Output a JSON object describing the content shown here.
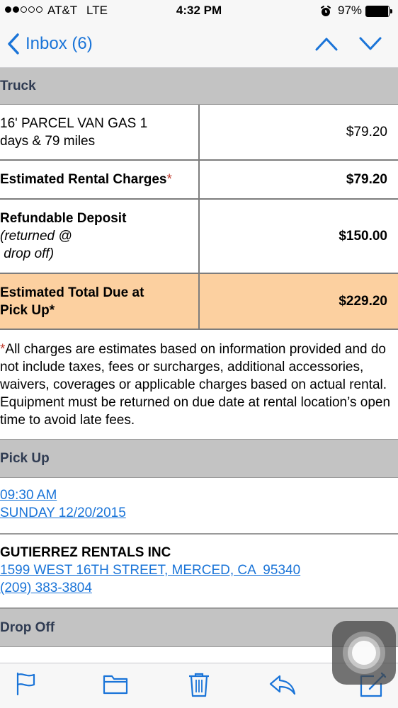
{
  "status_bar": {
    "carrier": "AT&T",
    "network": "LTE",
    "time": "4:32 PM",
    "battery": "97%",
    "battery_level": 0.97,
    "signal_bars": 2,
    "signal_total": 5
  },
  "nav": {
    "back_label": "Inbox (6)",
    "accent": "#1a74d8"
  },
  "email": {
    "truck_header": "Truck",
    "item": {
      "description_line1": "16' PARCEL VAN GAS 1",
      "description_line2": "days & 79 miles",
      "price": "$79.20"
    },
    "rental_charges": {
      "label": "Estimated Rental Charges",
      "asterisk": "*",
      "value": "$79.20"
    },
    "deposit": {
      "label": "Refundable Deposit",
      "note_line1": "(returned @",
      "note_line2": " drop off)",
      "value": "$150.00"
    },
    "total_due": {
      "label_line1": "Estimated Total Due at",
      "label_line2": "Pick Up*",
      "value": "$229.20",
      "highlight_color": "#fcd0a0"
    },
    "disclaimer": {
      "asterisk": "*",
      "text": "All charges are estimates based on information provided and do not include taxes, fees or surcharges, additional accessories, waivers, coverages or applicable charges based on actual rental. Equipment must be returned on due date at rental location’s open time to avoid late fees."
    },
    "pickup_header": "Pick Up",
    "pickup_time": "09:30 AM",
    "pickup_date": "SUNDAY 12/20/2015",
    "location": {
      "name": "GUTIERREZ RENTALS INC",
      "address": "1599 WEST 16TH STREET, MERCED, CA  95340",
      "phone": "(209) 383-3804"
    },
    "dropoff_header": "Drop Off"
  },
  "toolbar": {
    "icons": [
      "flag-icon",
      "folder-icon",
      "trash-icon",
      "reply-icon",
      "compose-icon"
    ]
  }
}
